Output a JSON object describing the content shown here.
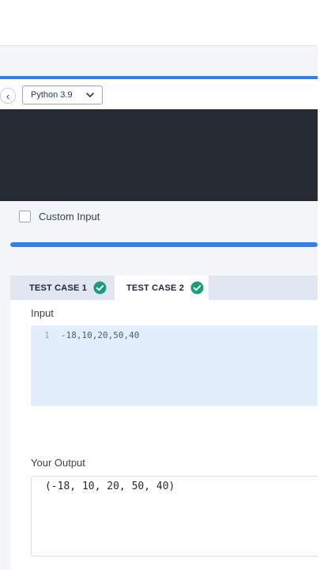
{
  "toolbar": {
    "collapse_glyph": "‹",
    "language": "Python 3.9"
  },
  "custom_input": {
    "label": "Custom Input",
    "checked": false
  },
  "progress": {
    "fraction": 1.0,
    "color": "#2f80ed"
  },
  "tabs": [
    {
      "label": "TEST CASE 1",
      "status": "passed",
      "active": false
    },
    {
      "label": "TEST CASE 2",
      "status": "passed",
      "active": true
    }
  ],
  "input_section": {
    "label": "Input",
    "line_number": "1",
    "line_text": "-18,10,20,50,40"
  },
  "output_section": {
    "label": "Your Output",
    "text": "(-18, 10, 20, 50, 40)"
  },
  "colors": {
    "accent": "#2f80ed",
    "success": "#1a9c7e",
    "editor_bg": "#262a33",
    "input_bg": "#e2eefc"
  }
}
